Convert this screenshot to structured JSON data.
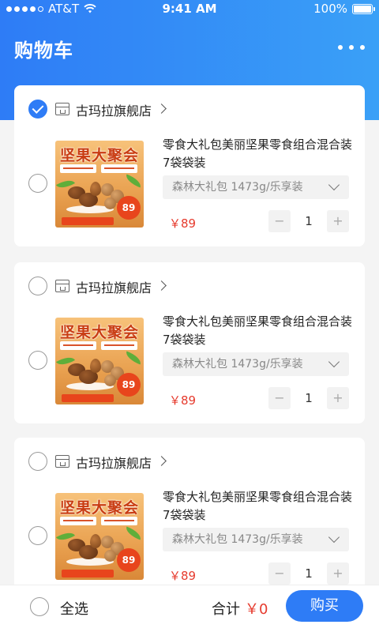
{
  "status": {
    "carrier": "AT&T",
    "time": "9:41 AM",
    "battery": "100%",
    "battery_level": 1.0
  },
  "header": {
    "title": "购物车",
    "more_icon": "more-dots-icon"
  },
  "cards": [
    {
      "store": "古玛拉旗舰店",
      "store_checked": true,
      "item_checked": false,
      "product": {
        "name": "零食大礼包美丽坚果零食组合混合装7袋袋装",
        "spec": "森林大礼包 1473g/乐享装",
        "price": "￥89",
        "qty": "1",
        "image_title": "坚果大聚会",
        "badge": "89"
      }
    },
    {
      "store": "古玛拉旗舰店",
      "store_checked": false,
      "item_checked": false,
      "product": {
        "name": "零食大礼包美丽坚果零食组合混合装7袋袋装",
        "spec": "森林大礼包 1473g/乐享装",
        "price": "￥89",
        "qty": "1",
        "image_title": "坚果大聚会",
        "badge": "89"
      }
    },
    {
      "store": "古玛拉旗舰店",
      "store_checked": false,
      "item_checked": false,
      "product": {
        "name": "零食大礼包美丽坚果零食组合混合装7袋袋装",
        "spec": "森林大礼包 1473g/乐享装",
        "price": "￥89",
        "qty": "1",
        "image_title": "坚果大聚会",
        "badge": "89"
      }
    }
  ],
  "stepper": {
    "minus": "−",
    "plus": "+"
  },
  "footer": {
    "select_all": "全选",
    "total_label": "合计",
    "total_value": "￥0",
    "buy": "购买"
  },
  "colors": {
    "primary": "#2e7cf6",
    "price": "#e63b2e"
  }
}
